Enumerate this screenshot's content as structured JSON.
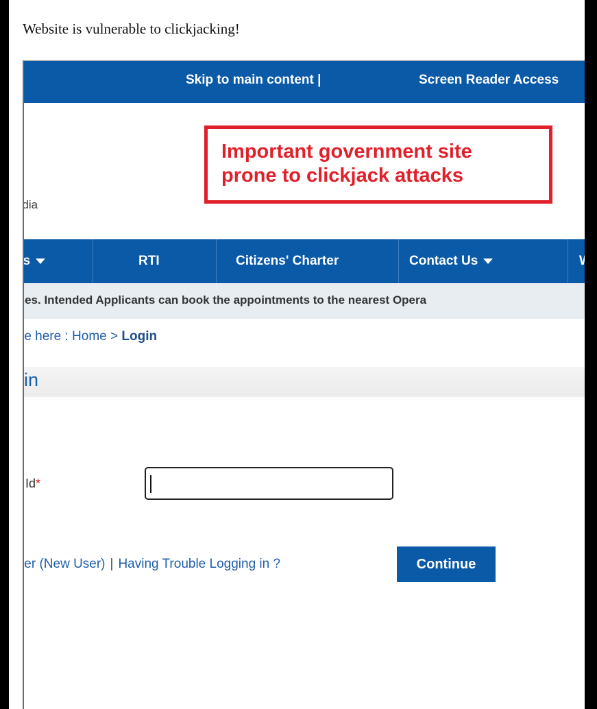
{
  "heading": "Website is vulnerable to clickjacking!",
  "topbar": {
    "skip_link": "Skip to main content  |",
    "screen_reader_link": "Screen Reader Access"
  },
  "org_fragment": "ndia",
  "callout": {
    "line1": "Important government site",
    "line2": "prone to clickjack attacks"
  },
  "nav": {
    "items": [
      {
        "label": "es"
      },
      {
        "label": "RTI"
      },
      {
        "label": "Citizens' Charter"
      },
      {
        "label": "Contact Us"
      },
      {
        "label": "W"
      }
    ]
  },
  "ticker": "ines. Intended Applicants can book the appointments to the nearest Opera",
  "breadcrumb": {
    "prefix": "re here : ",
    "home": "Home",
    "sep": " > ",
    "current": "Login"
  },
  "page_title": "in",
  "form": {
    "field_label": "Id",
    "required_mark": "*",
    "input_value": "",
    "register_link": "ter (New User)",
    "pipe": "|",
    "trouble_link": "Having Trouble Logging in ?",
    "continue_label": "Continue"
  },
  "colors": {
    "brand_blue": "#0a5aa8",
    "callout_red": "#e0202a"
  }
}
